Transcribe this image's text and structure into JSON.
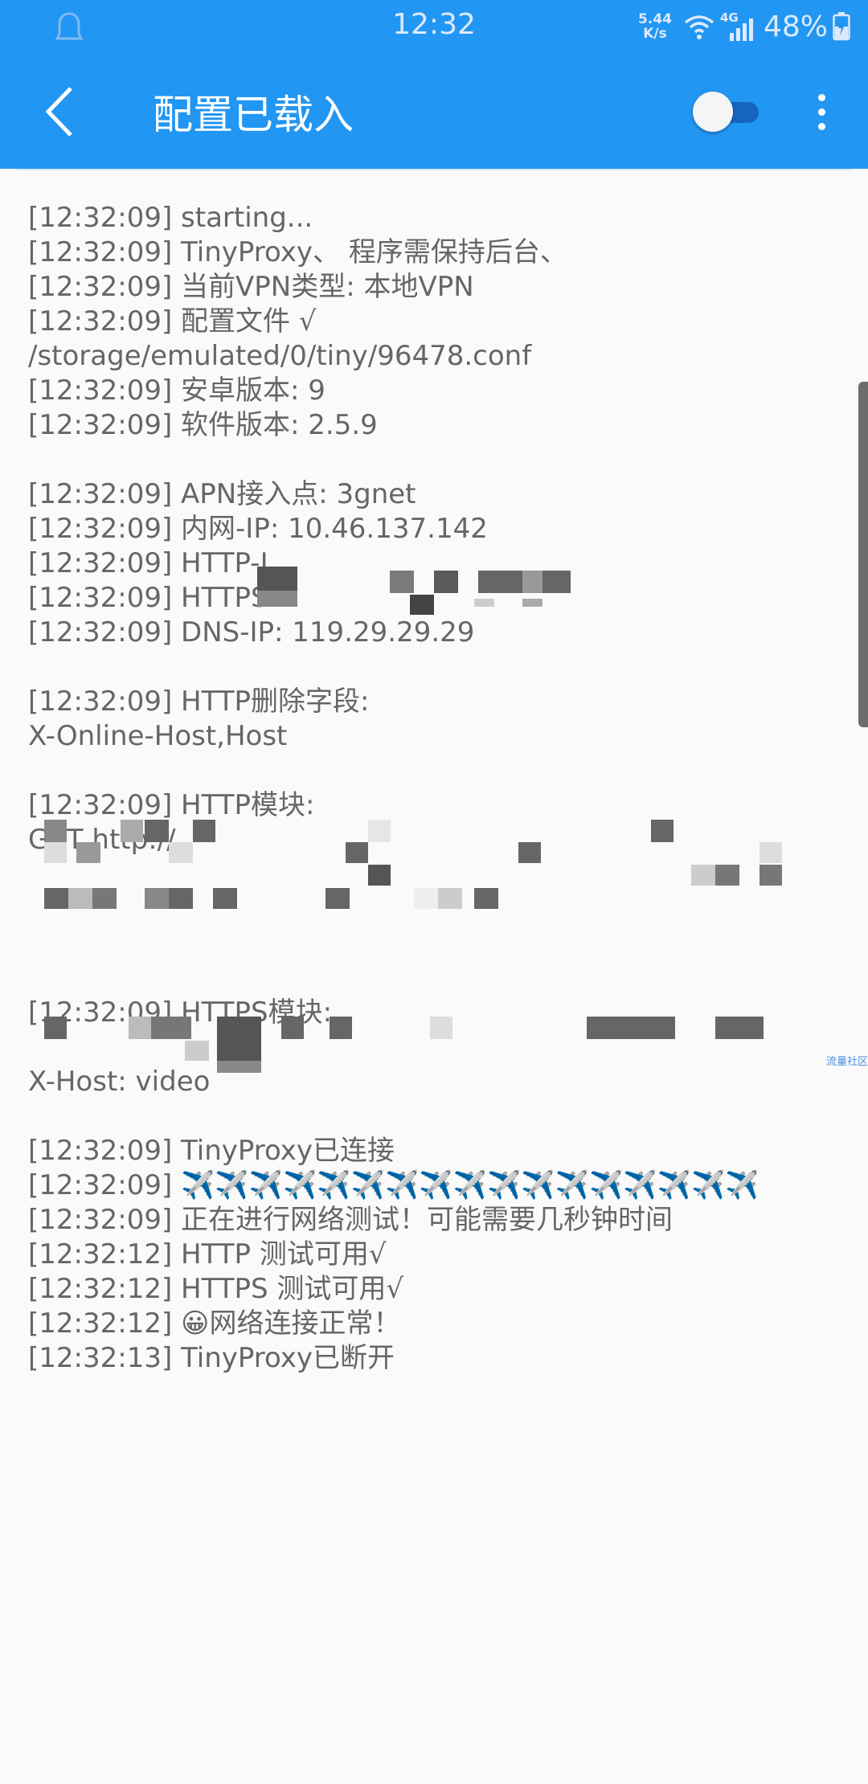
{
  "status_bar": {
    "time": "12:32",
    "speed_value": "5.44",
    "speed_unit": "K/s",
    "network": "4G",
    "battery": "48%"
  },
  "app_bar": {
    "title": "配置已载入",
    "toggle_on": false
  },
  "log_lines": [
    "[12:32:09] starting...",
    "[12:32:09] TinyProxy、 程序需保持后台、",
    "[12:32:09] 当前VPN类型: 本地VPN",
    "[12:32:09] 配置文件 √",
    "/storage/emulated/0/tiny/96478.conf",
    "[12:32:09] 安卓版本: 9",
    "[12:32:09] 软件版本: 2.5.9",
    "",
    "[12:32:09] APN接入点: 3gnet",
    "[12:32:09] 内网-IP: 10.46.137.142",
    "[12:32:09] HTTP-I",
    "[12:32:09] HTTPS-I",
    "[12:32:09] DNS-IP: 119.29.29.29",
    "",
    "[12:32:09] HTTP删除字段:",
    "X-Online-Host,Host",
    "",
    "[12:32:09] HTTP模块:",
    "GET http://",
    "",
    "",
    "",
    "",
    "[12:32:09] HTTPS模块:",
    "",
    "                    X-Host: video",
    "",
    "[12:32:09] TinyProxy已连接",
    "[12:32:09] ✈️✈️✈️✈️✈️✈️✈️✈️✈️✈️✈️✈️✈️✈️✈️✈️✈️",
    "[12:32:09] 正在进行网络测试！可能需要几秒钟时间",
    "[12:32:12] HTTP 测试可用√",
    "[12:32:12] HTTPS 测试可用√",
    "[12:32:12] 😀网络连接正常！",
    "[12:32:13] TinyProxy已断开"
  ],
  "watermark": "流量社区"
}
